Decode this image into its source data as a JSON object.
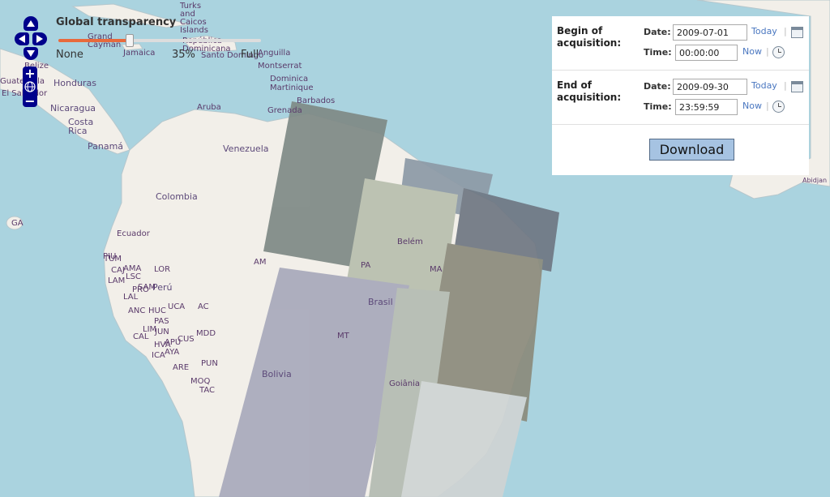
{
  "map": {
    "labels": {
      "venezuela": "Venezuela",
      "colombia": "Colombia",
      "ecuador": "Ecuador",
      "peru": "Perú",
      "brasil": "Brasil",
      "bolivia": "Bolivia",
      "panama": "Panamá",
      "costa_rica": "Costa\nRica",
      "nicaragua": "Nicaragua",
      "honduras": "Honduras",
      "jamaica": "Jamaica",
      "aruba": "Aruba",
      "barbados": "Barbados",
      "grenada": "Grenada",
      "dominica": "Dominica",
      "martinique": "Martinique",
      "montserrat": "Montserrat",
      "anguilla": "Anguilla",
      "turks": "Turks\nand\nCaicos\nIslands",
      "rep_dom": "República\nDominicana",
      "santo_domingo": "Santo Domingo",
      "grand_cayman": "Grand\nCayman",
      "guatemala": "Guatemala",
      "el_salvador": "El Salvador",
      "belize": "Belize",
      "ga": "GA",
      "abidjan": "Abidjan",
      "am": "AM",
      "pa": "PA",
      "ma": "MA",
      "ac": "AC",
      "mt": "MT",
      "belem": "Belém",
      "goiania": "Goiânia",
      "lor": "LOR",
      "sam": "SAM",
      "lam": "LAM",
      "lal": "LAL",
      "anc": "ANC",
      "huc": "HUC",
      "ucayali": "UCA",
      "pas": "PAS",
      "mdd": "MDD",
      "cus": "CUS",
      "apu": "APU",
      "jun": "JUN",
      "hva": "HVA",
      "ica": "ICA",
      "aya": "AYA",
      "pun": "PUN",
      "moq": "MOQ",
      "are": "ARE",
      "tac": "TAC",
      "lim": "LIM",
      "cal": "CAL",
      "piu": "PIU",
      "tum": "TUM",
      "ama": "AMA",
      "caj": "CAJ",
      "lsc": "LSC",
      "pro": "PRO"
    }
  },
  "navigation": {
    "up_icon": "arrow-up-icon",
    "down_icon": "arrow-down-icon",
    "left_icon": "arrow-left-icon",
    "right_icon": "arrow-right-icon",
    "zoom_in_label": "+",
    "zoom_out_label": "−",
    "world_icon": "globe-icon"
  },
  "transparency": {
    "title": "Global transparency",
    "min_label": "None",
    "value_label": "35%",
    "max_label": "Full",
    "value_fraction": 0.35,
    "track_color": "#e86a3c"
  },
  "acquisition": {
    "begin": {
      "title": "Begin of acquisition:",
      "date_label": "Date:",
      "date_value": "2009-07-01",
      "today_label": "Today",
      "time_label": "Time:",
      "time_value": "00:00:00",
      "now_label": "Now"
    },
    "end": {
      "title": "End of acquisition:",
      "date_label": "Date:",
      "date_value": "2009-09-30",
      "today_label": "Today",
      "time_label": "Time:",
      "time_value": "23:59:59",
      "now_label": "Now"
    },
    "separator": "|",
    "download_label": "Download"
  },
  "colors": {
    "ocean": "#aad3df",
    "land": "#f2efe9",
    "nav": "#00008b",
    "button_bg": "#a6c3e2",
    "link": "#4a77c0"
  }
}
